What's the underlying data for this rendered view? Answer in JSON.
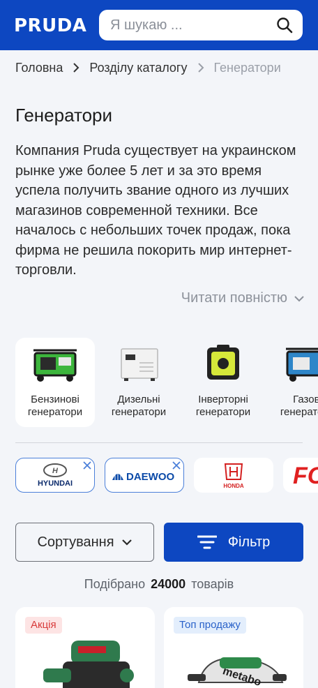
{
  "header": {
    "logo": "PRUDA",
    "search_placeholder": "Я шукаю ...",
    "brand_color": "#0d47c1"
  },
  "breadcrumb": [
    {
      "label": "Головна"
    },
    {
      "label": "Розділу каталогу"
    },
    {
      "label": "Генератори"
    }
  ],
  "page_title": "Генератори",
  "description": "Компания Pruda существует на украинском рынке уже более 5 лет и за это время успела получить звание одного из лучших магазинов современной техники. Все началось с небольших точек продаж, пока фирма не решила покорить мир интернет-торговли.",
  "read_more": "Читати повністю",
  "categories": [
    {
      "label": "Бензинові генератори",
      "icon": "petrol-generator-image",
      "active": true
    },
    {
      "label": "Дизельні генератори",
      "icon": "diesel-generator-image",
      "active": false
    },
    {
      "label": "Інверторні генератори",
      "icon": "inverter-generator-image",
      "active": false
    },
    {
      "label": "Газові генератори",
      "icon": "gas-generator-image",
      "active": false
    }
  ],
  "brands": [
    {
      "name": "HYUNDAI",
      "selected": true
    },
    {
      "name": "DAEWOO",
      "selected": true
    },
    {
      "name": "HONDA",
      "selected": false
    },
    {
      "name": "FORTE",
      "selected": false
    }
  ],
  "controls": {
    "sort_label": "Сортування",
    "filter_label": "Фільтр"
  },
  "results": {
    "prefix": "Подібрано",
    "count": "24000",
    "suffix": "товарів"
  },
  "products": [
    {
      "badge": "Акція",
      "badge_type": "sale",
      "image": "router-tool-image"
    },
    {
      "badge": "Топ продажу",
      "badge_type": "top",
      "image": "circular-saw-image"
    }
  ]
}
